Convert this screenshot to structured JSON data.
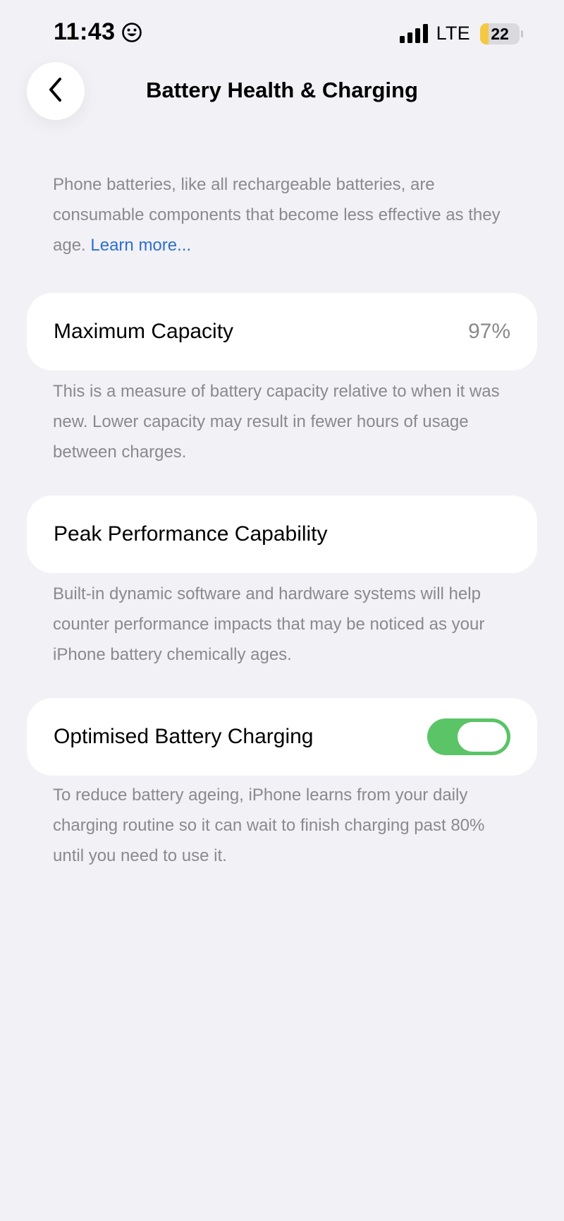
{
  "status_bar": {
    "time": "11:43",
    "time_icon": "smiley-icon",
    "network": "LTE",
    "battery_level": "22",
    "battery_percent": 22,
    "battery_color": "#f5c842"
  },
  "nav": {
    "back_icon": "chevron-left-icon",
    "title": "Battery Health & Charging"
  },
  "intro": {
    "text": "Phone batteries, like all rechargeable batteries, are consumable components that become less effective as they age.",
    "link": "Learn more..."
  },
  "maximum_capacity": {
    "label": "Maximum Capacity",
    "value": "97%",
    "footnote": "This is a measure of battery capacity relative to when it was new. Lower capacity may result in fewer hours of usage between charges."
  },
  "peak_performance": {
    "label": "Peak Performance Capability",
    "footnote": "Built-in dynamic software and hardware systems will help counter performance impacts that may be noticed as your iPhone battery chemically ages."
  },
  "optimised_charging": {
    "label": "Optimised Battery Charging",
    "enabled": true,
    "toggle_color": "#5ac466",
    "footnote": "To reduce battery ageing, iPhone learns from your daily charging routine so it can wait to finish charging past 80% until you need to use it."
  }
}
